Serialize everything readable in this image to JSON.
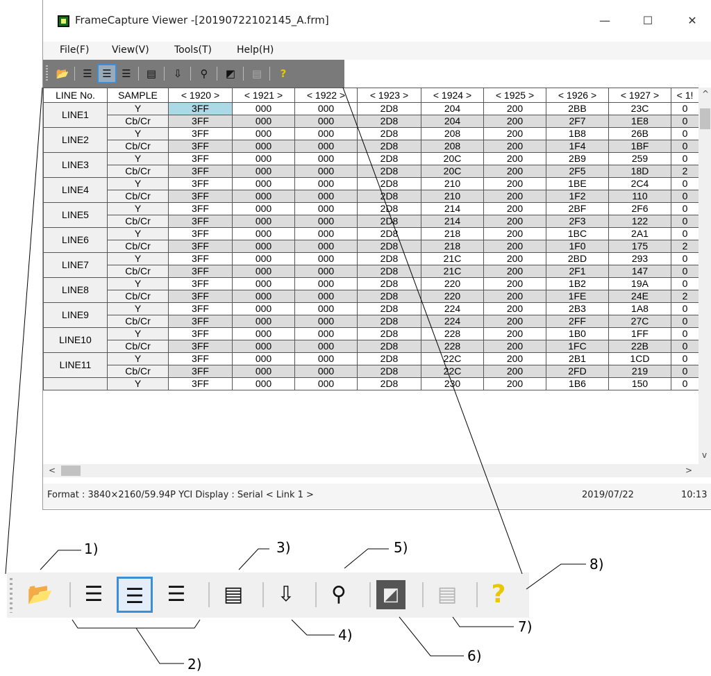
{
  "window": {
    "title": "FrameCapture Viewer -[20190722102145_A.frm]",
    "minimize": "—",
    "maximize": "☐",
    "close": "✕"
  },
  "menu": [
    "File(F)",
    "View(V)",
    "Tools(T)",
    "Help(H)"
  ],
  "grid": {
    "headers": [
      "LINE No.",
      "SAMPLE",
      "< 1920 >",
      "< 1921 >",
      "< 1922 >",
      "< 1923 >",
      "< 1924 >",
      "< 1925 >",
      "< 1926 >",
      "< 1927 >",
      "< 1!"
    ],
    "rows": [
      {
        "line": "LINE1",
        "y": [
          "3FF",
          "000",
          "000",
          "2D8",
          "204",
          "200",
          "2BB",
          "23C",
          "0"
        ],
        "c": [
          "3FF",
          "000",
          "000",
          "2D8",
          "204",
          "200",
          "2F7",
          "1E8",
          "0"
        ]
      },
      {
        "line": "LINE2",
        "y": [
          "3FF",
          "000",
          "000",
          "2D8",
          "208",
          "200",
          "1B8",
          "26B",
          "0"
        ],
        "c": [
          "3FF",
          "000",
          "000",
          "2D8",
          "208",
          "200",
          "1F4",
          "1BF",
          "0"
        ]
      },
      {
        "line": "LINE3",
        "y": [
          "3FF",
          "000",
          "000",
          "2D8",
          "20C",
          "200",
          "2B9",
          "259",
          "0"
        ],
        "c": [
          "3FF",
          "000",
          "000",
          "2D8",
          "20C",
          "200",
          "2F5",
          "18D",
          "2"
        ]
      },
      {
        "line": "LINE4",
        "y": [
          "3FF",
          "000",
          "000",
          "2D8",
          "210",
          "200",
          "1BE",
          "2C4",
          "0"
        ],
        "c": [
          "3FF",
          "000",
          "000",
          "2D8",
          "210",
          "200",
          "1F2",
          "110",
          "0"
        ]
      },
      {
        "line": "LINE5",
        "y": [
          "3FF",
          "000",
          "000",
          "2D8",
          "214",
          "200",
          "2BF",
          "2F6",
          "0"
        ],
        "c": [
          "3FF",
          "000",
          "000",
          "2D8",
          "214",
          "200",
          "2F3",
          "122",
          "0"
        ]
      },
      {
        "line": "LINE6",
        "y": [
          "3FF",
          "000",
          "000",
          "2D8",
          "218",
          "200",
          "1BC",
          "2A1",
          "0"
        ],
        "c": [
          "3FF",
          "000",
          "000",
          "2D8",
          "218",
          "200",
          "1F0",
          "175",
          "2"
        ]
      },
      {
        "line": "LINE7",
        "y": [
          "3FF",
          "000",
          "000",
          "2D8",
          "21C",
          "200",
          "2BD",
          "293",
          "0"
        ],
        "c": [
          "3FF",
          "000",
          "000",
          "2D8",
          "21C",
          "200",
          "2F1",
          "147",
          "0"
        ]
      },
      {
        "line": "LINE8",
        "y": [
          "3FF",
          "000",
          "000",
          "2D8",
          "220",
          "200",
          "1B2",
          "19A",
          "0"
        ],
        "c": [
          "3FF",
          "000",
          "000",
          "2D8",
          "220",
          "200",
          "1FE",
          "24E",
          "2"
        ]
      },
      {
        "line": "LINE9",
        "y": [
          "3FF",
          "000",
          "000",
          "2D8",
          "224",
          "200",
          "2B3",
          "1A8",
          "0"
        ],
        "c": [
          "3FF",
          "000",
          "000",
          "2D8",
          "224",
          "200",
          "2FF",
          "27C",
          "0"
        ]
      },
      {
        "line": "LINE10",
        "y": [
          "3FF",
          "000",
          "000",
          "2D8",
          "228",
          "200",
          "1B0",
          "1FF",
          "0"
        ],
        "c": [
          "3FF",
          "000",
          "000",
          "2D8",
          "228",
          "200",
          "1FC",
          "22B",
          "0"
        ]
      },
      {
        "line": "LINE11",
        "y": [
          "3FF",
          "000",
          "000",
          "2D8",
          "22C",
          "200",
          "2B1",
          "1CD",
          "0"
        ],
        "c": [
          "3FF",
          "000",
          "000",
          "2D8",
          "22C",
          "200",
          "2FD",
          "219",
          "0"
        ]
      },
      {
        "line": "",
        "y": [
          "3FF",
          "000",
          "000",
          "2D8",
          "230",
          "200",
          "1B6",
          "150",
          "0"
        ],
        "c": []
      }
    ],
    "y_label": "Y",
    "c_label": "Cb/Cr"
  },
  "status": {
    "format": "Format : 3840×2160/59.94P YCI Display : Serial < Link 1 >",
    "date": "2019/07/22",
    "time": "10:13"
  },
  "callouts": [
    "1)",
    "2)",
    "3)",
    "4)",
    "5)",
    "6)",
    "7)",
    "8)"
  ],
  "colors": {
    "selected_cell": "#abd9e6",
    "selected_border": "#3b8fd9",
    "toolbar_bg": "#7a7a7a"
  }
}
